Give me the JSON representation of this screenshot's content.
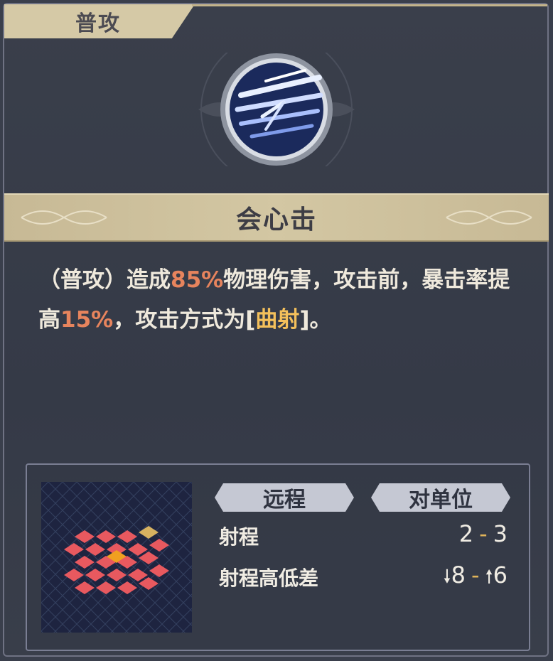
{
  "tab": {
    "label": "普攻"
  },
  "skill": {
    "name": "会心击",
    "icon": "feather-strike-icon",
    "desc_1": "（普攻）造成",
    "desc_2": "85%",
    "desc_3": "物理伤害，攻击前，暴击率提高",
    "desc_4": "15%",
    "desc_5": "，攻击方式为[",
    "desc_6": "曲射",
    "desc_7": "]。"
  },
  "tags": {
    "range_type": "远程",
    "target_type": "对单位"
  },
  "stats": {
    "range_label": "射程",
    "range_min": "2",
    "range_max": "3",
    "height_label": "射程高低差",
    "height_down": "8",
    "height_up": "6",
    "dash": "-"
  },
  "colors": {
    "frame_gold": "#d5c9a6",
    "highlight_red": "#e7845d",
    "highlight_gold": "#f4c05b",
    "grid_tile_red": "#e8595f",
    "grid_tile_orange": "#f0a020",
    "grid_tile_gold": "#d6b160"
  }
}
